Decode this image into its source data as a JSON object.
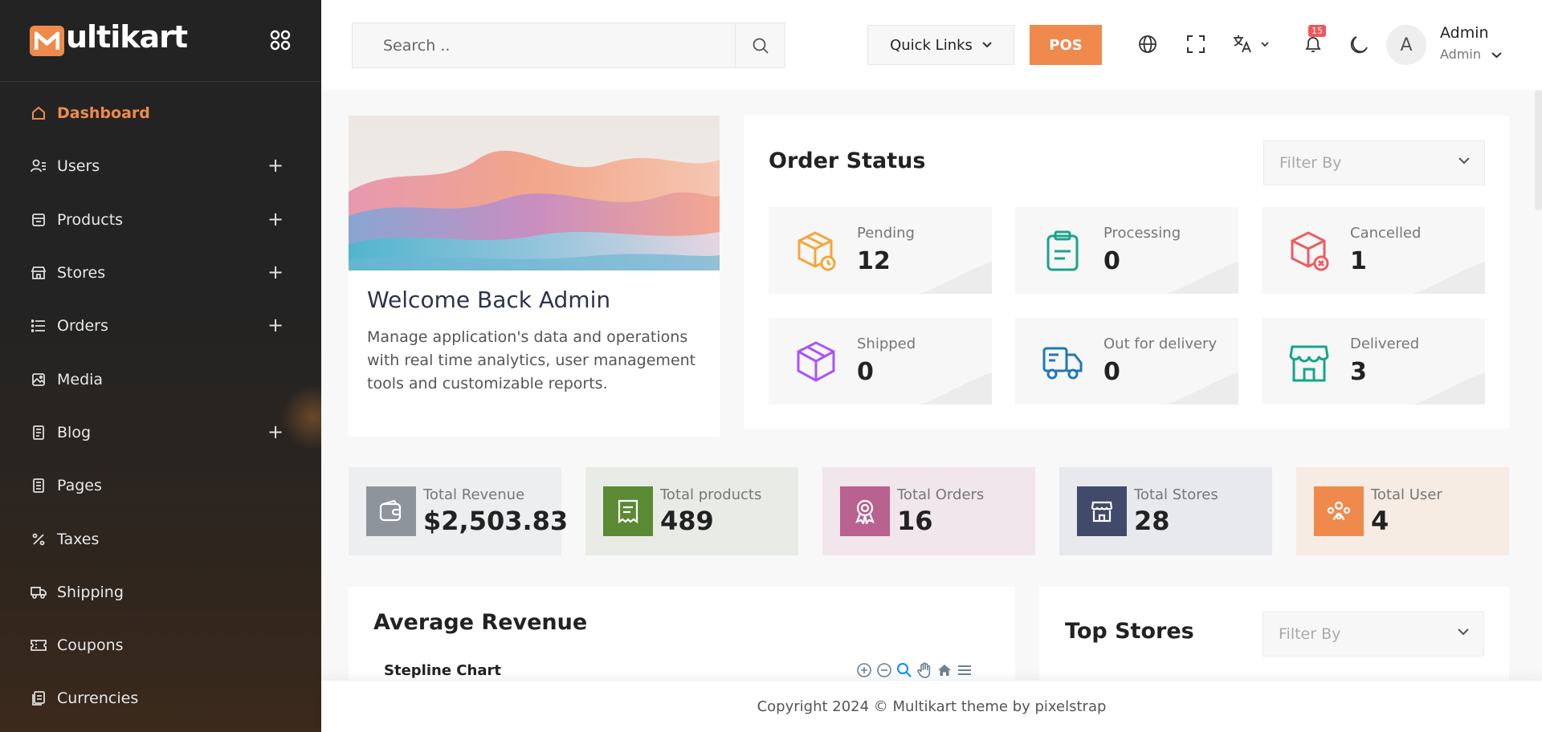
{
  "brand": {
    "name": "ultikart",
    "mark": "M",
    "accent": "#ef8a4c"
  },
  "sidebar": {
    "items": [
      {
        "label": "Dashboard",
        "icon": "home-icon",
        "active": true,
        "expandable": false
      },
      {
        "label": "Users",
        "icon": "users-icon",
        "expandable": true
      },
      {
        "label": "Products",
        "icon": "products-icon",
        "expandable": true
      },
      {
        "label": "Stores",
        "icon": "store-icon",
        "expandable": true
      },
      {
        "label": "Orders",
        "icon": "list-icon",
        "expandable": true
      },
      {
        "label": "Media",
        "icon": "image-icon",
        "expandable": false
      },
      {
        "label": "Blog",
        "icon": "blog-icon",
        "expandable": true
      },
      {
        "label": "Pages",
        "icon": "pages-icon",
        "expandable": false
      },
      {
        "label": "Taxes",
        "icon": "percent-icon",
        "expandable": false
      },
      {
        "label": "Shipping",
        "icon": "truck-icon",
        "expandable": false
      },
      {
        "label": "Coupons",
        "icon": "coupon-icon",
        "expandable": false
      },
      {
        "label": "Currencies",
        "icon": "currency-icon",
        "expandable": false
      }
    ],
    "expand_symbol": "+"
  },
  "topbar": {
    "search_placeholder": "Search ..",
    "quick_links": "Quick Links",
    "pos": "POS",
    "notification_count": "15",
    "avatar_initial": "A",
    "user_name": "Admin",
    "user_role": "Admin"
  },
  "welcome": {
    "title": "Welcome Back Admin",
    "text": "Manage application's data and operations with real time analytics, user management tools and customizable reports."
  },
  "order_status": {
    "title": "Order Status",
    "filter_placeholder": "Filter By",
    "tiles": [
      {
        "label": "Pending",
        "value": "12",
        "icon": "pending-box-icon",
        "color": "#f6a53a"
      },
      {
        "label": "Processing",
        "value": "0",
        "icon": "clipboard-icon",
        "color": "#17a589"
      },
      {
        "label": "Cancelled",
        "value": "1",
        "icon": "cancelled-box-icon",
        "color": "#ef5b61"
      },
      {
        "label": "Shipped",
        "value": "0",
        "icon": "shipped-box-icon",
        "color": "#a855f7"
      },
      {
        "label": "Out for delivery",
        "value": "0",
        "icon": "delivery-truck-icon",
        "color": "#1f78b4"
      },
      {
        "label": "Delivered",
        "value": "3",
        "icon": "delivered-store-icon",
        "color": "#17a589"
      }
    ]
  },
  "stats": [
    {
      "label": "Total Revenue",
      "value": "$2,503.83",
      "icon": "wallet-icon",
      "bg": "#eceef0",
      "box": "#8d949c"
    },
    {
      "label": "Total products",
      "value": "489",
      "icon": "receipt-icon",
      "bg": "#e9ece6",
      "box": "#5a8a33"
    },
    {
      "label": "Total Orders",
      "value": "16",
      "icon": "award-icon",
      "bg": "#f1e6ec",
      "box": "#b9618f"
    },
    {
      "label": "Total Stores",
      "value": "28",
      "icon": "shop-icon",
      "bg": "#e8e9ec",
      "box": "#424a6b"
    },
    {
      "label": "Total User",
      "value": "4",
      "icon": "user-group-icon",
      "bg": "#f6ece4",
      "box": "#ef8a4c"
    }
  ],
  "average_revenue": {
    "title": "Average Revenue",
    "chart_title": "Stepline Chart"
  },
  "top_stores": {
    "title": "Top Stores",
    "filter_placeholder": "Filter By"
  },
  "footer": {
    "copyright": "Copyright 2024 © Multikart theme by pixelstrap"
  }
}
